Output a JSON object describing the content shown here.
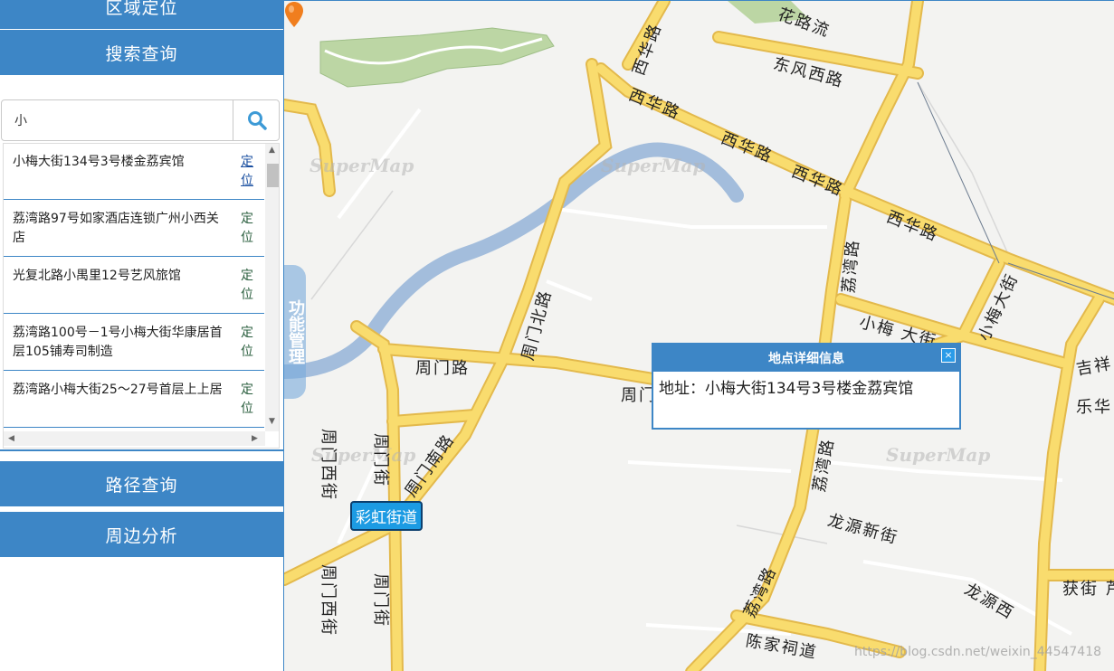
{
  "sidebar": {
    "sections": {
      "area_locate": "区域定位",
      "search_query": "搜索查询",
      "route_query": "路径查询",
      "nearby_analysis": "周边分析"
    },
    "search": {
      "value": "小",
      "icon": "search-icon"
    },
    "results": [
      {
        "name": "小梅大街134号3号楼金荔宾馆",
        "locate": "定位"
      },
      {
        "name": "荔湾路97号如家酒店连锁广州小西关店",
        "locate": "定位"
      },
      {
        "name": "光复北路小禺里12号艺风旅馆",
        "locate": "定位"
      },
      {
        "name": "荔湾路100号－1号小梅大街华康居首层105铺寿司制造",
        "locate": "定位"
      },
      {
        "name": "荔湾路小梅大街25～27号首层上上居",
        "locate": "定位"
      }
    ]
  },
  "map": {
    "function_tab": "功能管理",
    "watermark": "SuperMap",
    "street_tag": "彩虹街道",
    "popup": {
      "title": "地点详细信息",
      "close": "×",
      "address": "地址：小梅大街134号3号楼金荔宾馆"
    },
    "labels": {
      "huahualiu": "花路流",
      "dongfeng_xilu": "东风西路",
      "xihua_1": "西华路",
      "xihua_2": "西华路",
      "xihua_3": "西华路",
      "xihua_4": "西华路",
      "xihua_5": "西华路",
      "liwan_1": "荔湾路",
      "liwan_2": "荔湾路",
      "liwan_3": "荔湾路",
      "xiaomei_1": "小梅大街",
      "xiaomei_2": "小梅 大街",
      "zhoumen_road": "周门路",
      "zhoumen_road2": "周门",
      "zhoumen_north": "周门北路",
      "zhoumen_south": "周门南路",
      "zhoumen_west1": "周门西街",
      "zhoumen_west2": "周门西街",
      "zhoumen_st1": "周门街",
      "zhoumen_st2": "周门街",
      "longyuan_new": "龙源新街",
      "longyuan_west": "龙源西",
      "chenjia": "陈家祠道",
      "jixiang": "吉祥",
      "le": "乐华",
      "huojie": "获街 芦",
      "credit": "https://blog.csdn.net/weixin_44547418"
    },
    "colors": {
      "road": "#f9dc6e",
      "road_edge": "#e3b94c",
      "river": "#a3bddc",
      "park": "#bcd6a4",
      "marker": "#f07e1e"
    }
  }
}
